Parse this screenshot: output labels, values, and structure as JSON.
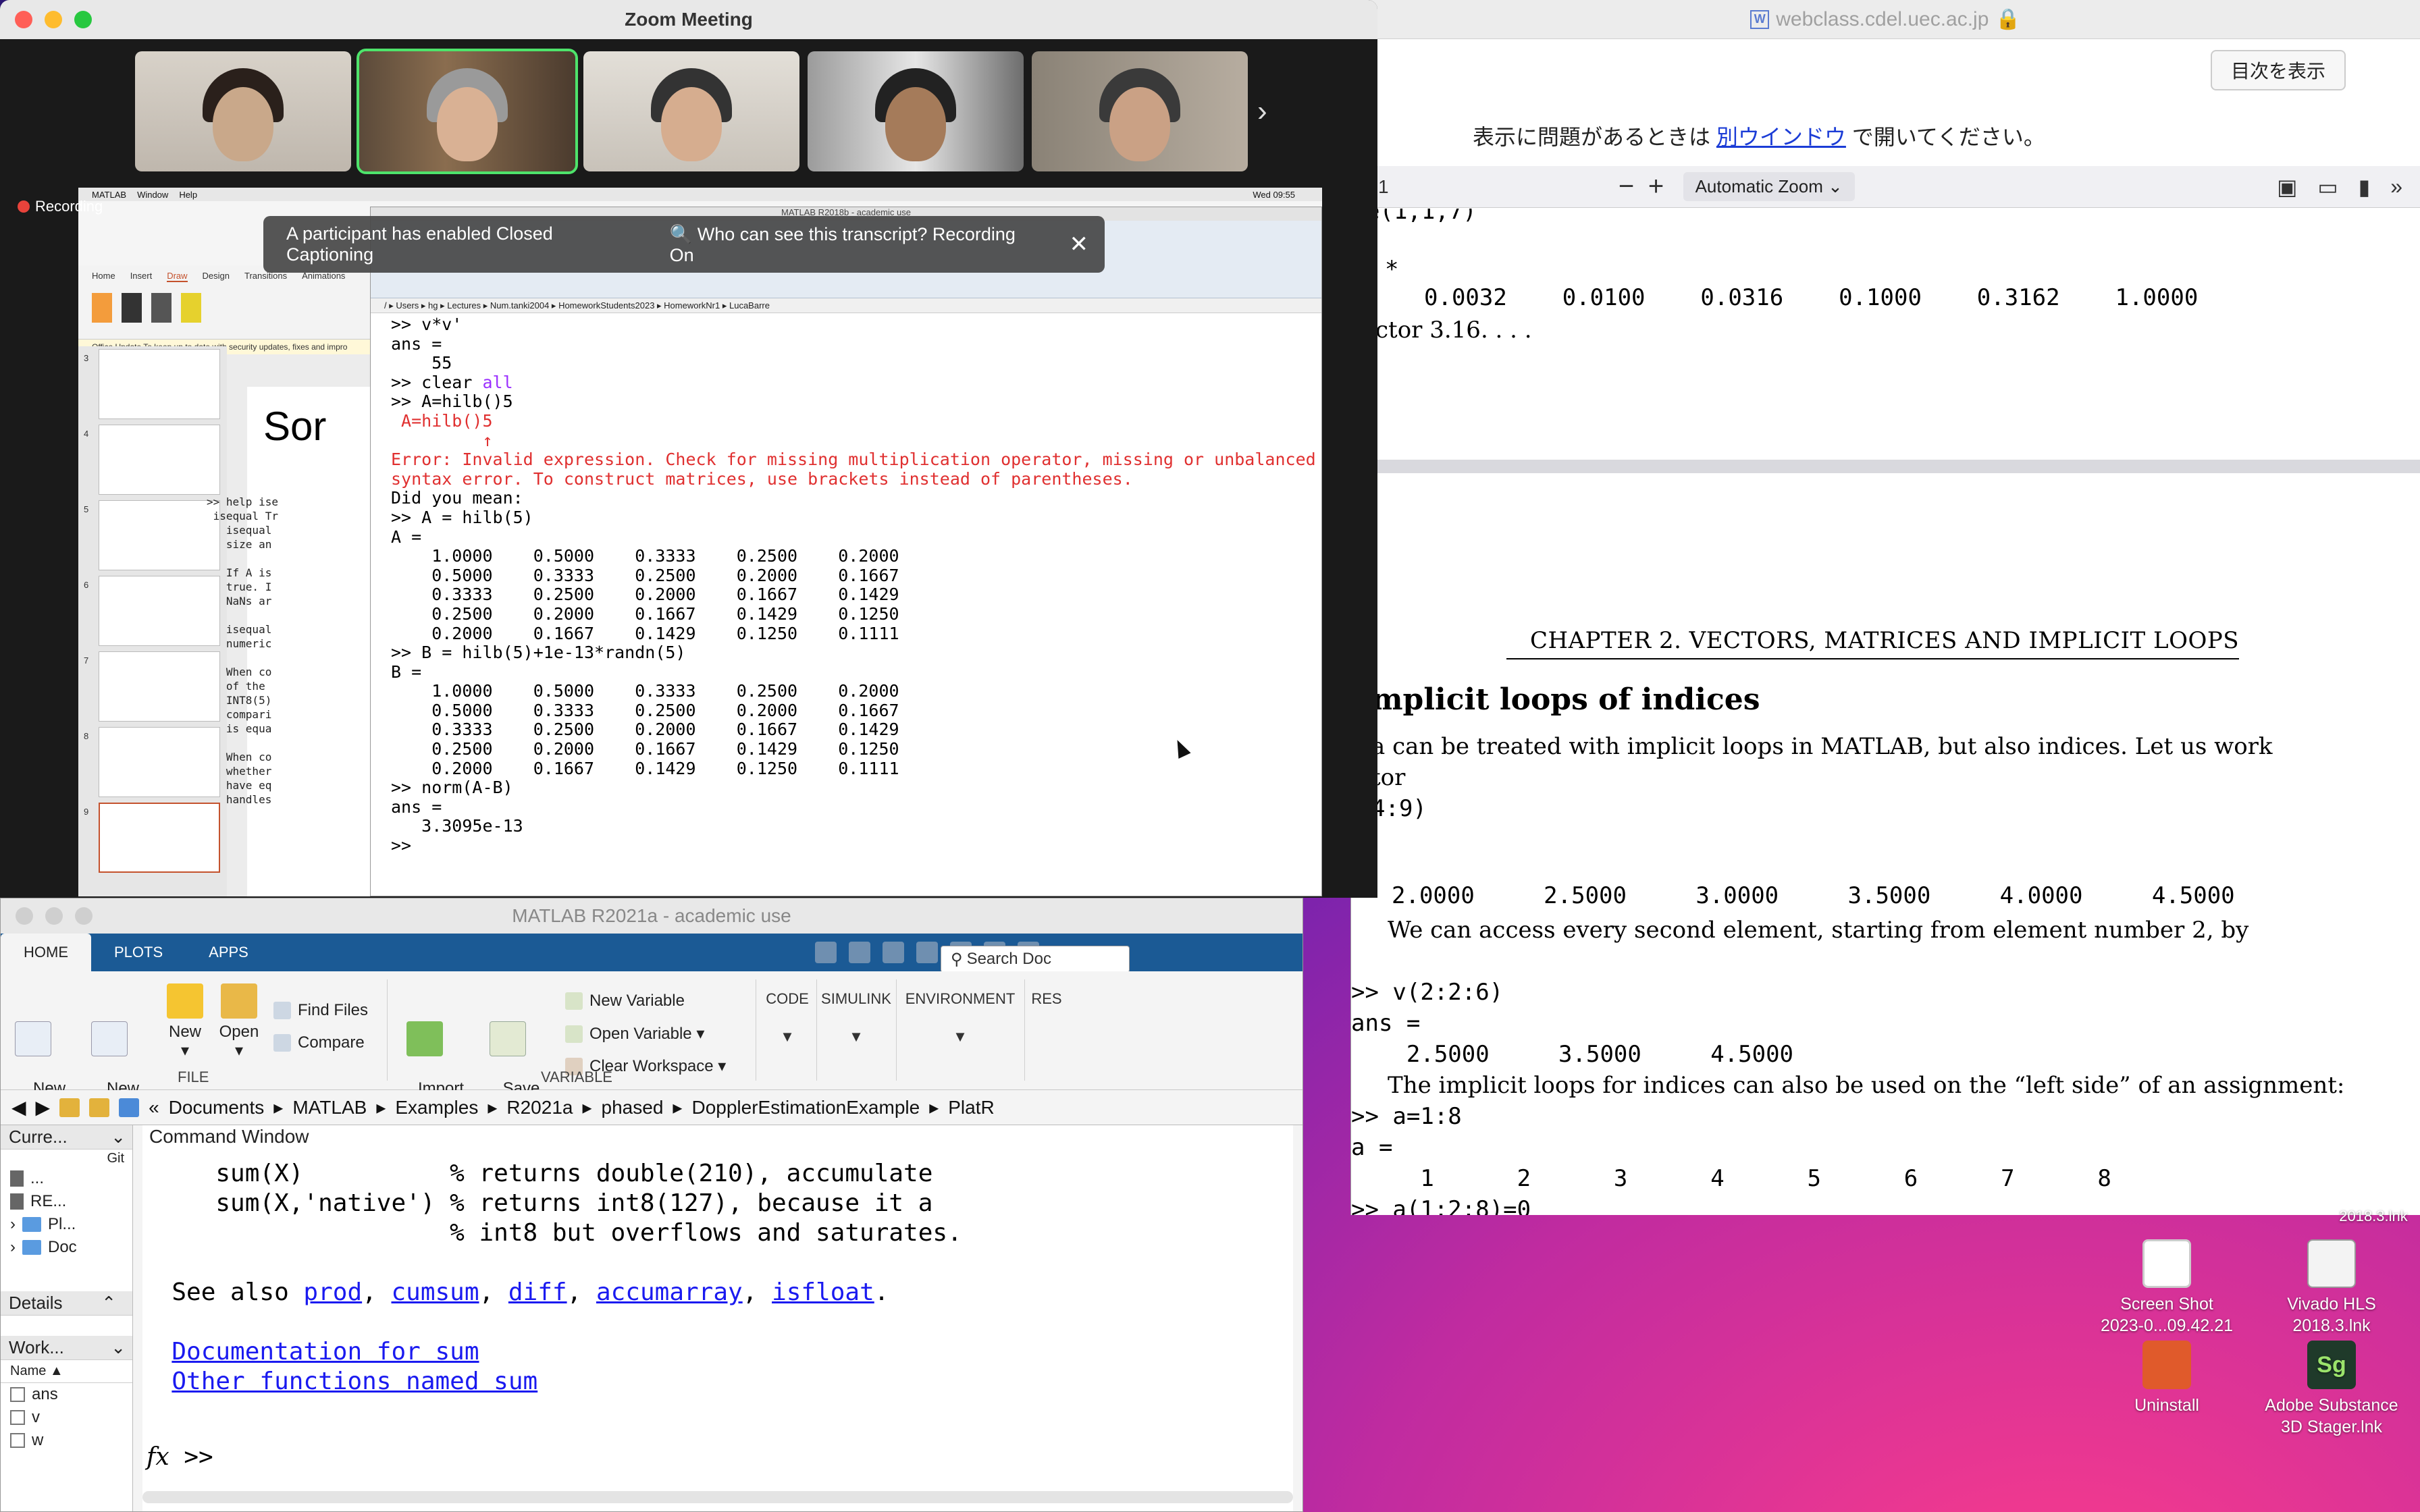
{
  "browser": {
    "domain": "webclass.cdel.uec.ac.jp",
    "toc_button": "目次を表示",
    "notice_before": "表示に問題があるときは",
    "notice_link": "別ウインドウ",
    "notice_after": "で開いてください。",
    "page_fragment": "1",
    "zoom_level": "Automatic Zoom",
    "page1": {
      "line_a": "e(1,1,7)",
      "line_b": "*",
      "values": "0.0032    0.0100    0.0316    0.1000    0.3162    1.0000",
      "line_d": "ctor 3.16. . . ."
    },
    "chapter": "CHAPTER 2.  VECTORS, MATRICES AND IMPLICIT LOOPS",
    "section": "mplicit loops of indices",
    "body1_line1": "a can be treated with implicit loops in MATLAB, but also indices. Let us work",
    "body1_line2": "tor",
    "body1_line3": "4:9)",
    "out1": "2.0000     2.5000     3.0000     3.5000     4.0000     4.5000",
    "body2": "     We can access every second element, starting from element number 2, by",
    "code2": ">> v(2:2:6)\nans =\n    2.5000     3.5000     4.5000",
    "body3": "     The implicit loops for indices can also be used on the “left side” of an assignment:",
    "code3": ">> a=1:8\na =\n     1      2      3      4      5      6      7      8\n>> a(1:2:8)=0"
  },
  "zoom": {
    "title": "Zoom Meeting",
    "recording": "Recording",
    "caption_notice": "A participant has enabled Closed Captioning",
    "transcript_notice": "Who can see this transcript? Recording On",
    "participants": [
      "participant-1",
      "participant-2",
      "participant-3",
      "participant-4",
      "participant-5"
    ]
  },
  "shared_screen": {
    "menu": [
      "MATLAB",
      "Window",
      "Help"
    ],
    "clock": "Wed 09:55",
    "matlab18_title": "MATLAB R2018b - academic use",
    "path": "/  ▸  Users  ▸  hg  ▸  Lectures  ▸  Num.tanki2004  ▸  HomeworkStudents2023  ▸  HomeworkNr1  ▸  LucaBarre",
    "ppt_tabs": [
      "Home",
      "Insert",
      "Draw",
      "Design",
      "Transitions",
      "Animations"
    ],
    "ppt_update": "Office Update  To keep up to date with security updates, fixes and impro",
    "slide_title": "Sor",
    "slide_numbers": [
      "3",
      "4",
      "5",
      "6",
      "7",
      "8",
      "9"
    ],
    "console": [
      ">> v*v'",
      "ans =",
      "    55",
      ">> clear all",
      ">> A=hilb()5",
      " A=hilb()5",
      "         ↑",
      "Error: Invalid expression. Check for missing multiplication operator, missing or unbalanced delimiter",
      "syntax error. To construct matrices, use brackets instead of parentheses.",
      "",
      "Did you mean:",
      ">> A = hilb(5)",
      "A =",
      "    1.0000    0.5000    0.3333    0.2500    0.2000",
      "    0.5000    0.3333    0.2500    0.2000    0.1667",
      "    0.3333    0.2500    0.2000    0.1667    0.1429",
      "    0.2500    0.2000    0.1667    0.1429    0.1250",
      "    0.2000    0.1667    0.1429    0.1250    0.1111",
      ">> B = hilb(5)+1e-13*randn(5)",
      "B =",
      "    1.0000    0.5000    0.3333    0.2500    0.2000",
      "    0.5000    0.3333    0.2500    0.2000    0.1667",
      "    0.3333    0.2500    0.2000    0.1667    0.1429",
      "    0.2500    0.2000    0.1667    0.1429    0.1250",
      "    0.2000    0.1667    0.1429    0.1250    0.1111",
      ">> norm(A-B)",
      "ans =",
      "   3.3095e-13",
      ">>"
    ],
    "help_text": ">> help ise\n isequal Tr\n   isequal\n   size an\n\n   If A is\n   true. I\n   NaNs ar\n\n   isequal\n   numeric\n\n   When co\n   of the \n   INT8(5)\n   compari\n   is equa\n\n   When co\n   whether\n   have eq\n   handles"
  },
  "matlab21": {
    "title": "MATLAB R2021a - academic use",
    "tabs": [
      "HOME",
      "PLOTS",
      "APPS"
    ],
    "search": "Search Doc",
    "buttons": {
      "new_script": "New\nScript",
      "new_live_script": "New\nLive Script",
      "new": "New",
      "open": "Open",
      "find_files": "Find Files",
      "compare": "Compare",
      "import_data": "Import\nData",
      "save_workspace": "Save\nWorkspace",
      "new_variable": "New Variable",
      "open_variable": "Open Variable ▾",
      "clear_workspace": "Clear Workspace  ▾"
    },
    "sections": {
      "file": "FILE",
      "variable": "VARIABLE",
      "code": "CODE",
      "simulink": "SIMULINK",
      "environment": "ENVIRONMENT",
      "res": "RES"
    },
    "address": [
      "«",
      "Documents",
      "▸",
      "MATLAB",
      "▸",
      "Examples",
      "▸",
      "R2021a",
      "▸",
      "phased",
      "▸",
      "DopplerEstimationExample",
      "▸",
      "PlatR"
    ],
    "current_folder_label": "Curre...",
    "git_label": "Git",
    "folder_rows": [
      "...",
      "RE...",
      "Pl...",
      "Doc"
    ],
    "details_label": "Details",
    "workspace_label": "Work...",
    "name_col": "Name ▲",
    "variables": [
      "ans",
      "v",
      "w"
    ],
    "cmd_title": "Command Window",
    "cmd_lines": [
      "     sum(X)          % returns double(210), accumulate",
      "     sum(X,'native') % returns int8(127), because it a",
      "                     % int8 but overflows and saturates."
    ],
    "see_also_prefix": "  See also ",
    "see_also": [
      "prod",
      "cumsum",
      "diff",
      "accumarray",
      "isfloat"
    ],
    "doc_link": "Documentation for sum",
    "other_link": "Other functions named sum",
    "prompt": ">>"
  },
  "desktop": {
    "icons": [
      {
        "label1": "Screen Shot",
        "label2": "2023-0...09.42.21"
      },
      {
        "label1": "Vivado HLS",
        "label2": "2018.3.lnk"
      },
      {
        "label1": "Uninstall",
        "label2": ""
      },
      {
        "label1": "Adobe Substance",
        "label2": "3D Stager.lnk"
      }
    ],
    "partial_label": "2018.3.lnk"
  }
}
